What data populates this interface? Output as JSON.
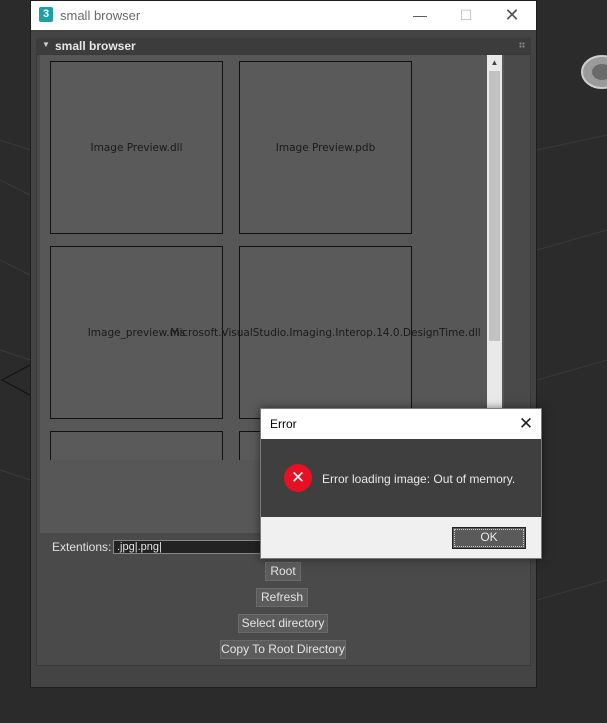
{
  "window": {
    "app_icon_glyph": "3",
    "title": "small browser",
    "minimize_glyph": "—",
    "maximize_glyph": "☐",
    "close_glyph": "✕"
  },
  "rollout": {
    "arrow_glyph": "▼",
    "title": "small browser"
  },
  "browser": {
    "tiles": [
      {
        "label": "Image Preview.dll"
      },
      {
        "label": "Image Preview.pdb"
      },
      {
        "label": "Image_preview.ms"
      },
      {
        "label": "Microsoft.VisualStudio.Imaging.Interop.14.0.DesignTime.dll"
      },
      {
        "label": ""
      },
      {
        "label": ""
      }
    ],
    "scroll_up_glyph": "▲"
  },
  "controls": {
    "extensions_label": "Extentions:",
    "extensions_value": ".jpg|.png|",
    "root_label": "Root",
    "refresh_label": "Refresh",
    "select_directory_label": "Select directory",
    "copy_to_root_label": "Copy To Root Directory"
  },
  "error_dialog": {
    "title": "Error",
    "close_glyph": "✕",
    "icon_glyph": "✕",
    "message": "Error loading image: Out of memory.",
    "ok_label": "OK"
  },
  "colors": {
    "app_icon": "#1ba1a6",
    "error_icon": "#e81123",
    "panel_bg": "#444444",
    "viewport_bg": "#2b2b2b"
  }
}
